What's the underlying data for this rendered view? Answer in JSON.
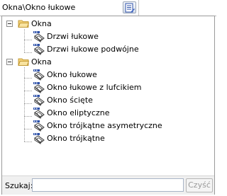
{
  "header": {
    "path": "Okna\\Okno łukowe",
    "icon": "list-edit-icon"
  },
  "tree": {
    "groups": [
      {
        "label": "Okna",
        "icon": "folder-open-icon",
        "items": [
          {
            "label": "Drzwi łukowe",
            "icon": "window-shape-icon"
          },
          {
            "label": "Drzwi łukowe podwójne",
            "icon": "window-shape-icon"
          }
        ]
      },
      {
        "label": "Okna",
        "icon": "folder-open-icon",
        "items": [
          {
            "label": "Okno łukowe",
            "icon": "window-shape-icon"
          },
          {
            "label": "Okno łukowe z lufcikiem",
            "icon": "window-shape-icon"
          },
          {
            "label": "Okno ścięte",
            "icon": "window-shape-icon"
          },
          {
            "label": "Okno eliptyczne",
            "icon": "window-shape-icon"
          },
          {
            "label": "Okno trójkątne asymetryczne",
            "icon": "window-shape-icon"
          },
          {
            "label": "Okno trójkątne",
            "icon": "window-shape-icon"
          }
        ]
      }
    ]
  },
  "search": {
    "label": "Szukaj:",
    "value": "",
    "clear_label": "Czyść"
  },
  "colors": {
    "folder": "#e8b94a",
    "item_icon_blue": "#2b4fa8"
  }
}
